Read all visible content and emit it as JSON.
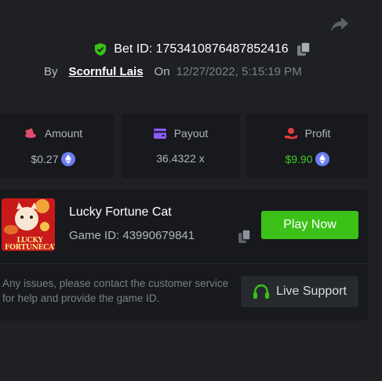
{
  "colors": {
    "background": "#1e2024",
    "card": "#17191c",
    "accent_green": "#3bc117",
    "profit_green": "#43c924",
    "coin_blue": "#6d7cf0",
    "amount_icon": "#e24a6d",
    "payout_icon": "#8b5cf6",
    "profit_icon": "#e23b3b"
  },
  "header": {
    "share_icon": "share-icon",
    "bet_id_text": "Bet ID: 1753410876487852416",
    "verified_icon": "shield-check-icon",
    "copy_icon": "copy-icon"
  },
  "author": {
    "by_label": "By",
    "user_name": "Scornful Lais",
    "on_label": "On",
    "date": "12/27/2022, 5:15:19 PM"
  },
  "stats": {
    "amount": {
      "label": "Amount",
      "value": "$0.27",
      "icon": "coins-icon",
      "currency_icon": "eth-coin-icon"
    },
    "payout": {
      "label": "Payout",
      "value": "36.4322 x",
      "icon": "wallet-icon"
    },
    "profit": {
      "label": "Profit",
      "value": "$9.90",
      "icon": "hand-coin-icon",
      "currency_icon": "eth-coin-icon"
    }
  },
  "game": {
    "title": "Lucky Fortune Cat",
    "id_text": "Game ID: 43990679841",
    "thumbnail_text": "LUCKY FORTUNECAT",
    "play_label": "Play Now",
    "help_text": "Any issues, please contact the customer service for help and provide the game ID.",
    "support_label": "Live Support",
    "support_icon": "headset-icon"
  }
}
